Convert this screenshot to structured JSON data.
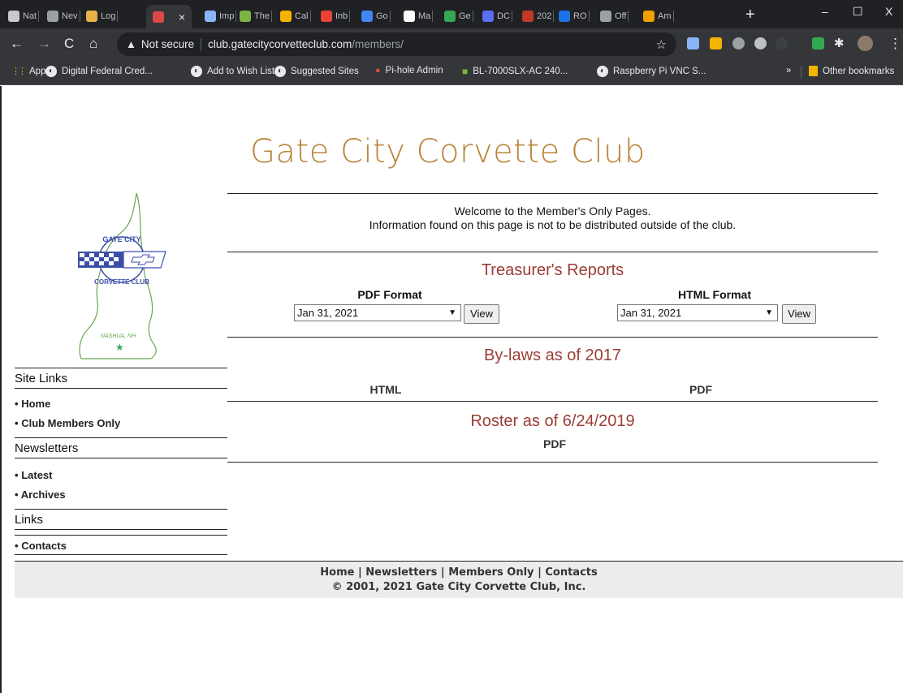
{
  "browser": {
    "tabs": [
      {
        "label": "Nat",
        "color": "#c9c9c9"
      },
      {
        "label": "Nev",
        "color": "#9aa0a6"
      },
      {
        "label": "Log",
        "color": "#e8b04b"
      },
      {
        "label": "",
        "color": "#e04848",
        "active": true
      },
      {
        "label": "Imp",
        "color": "#8ab4f8"
      },
      {
        "label": "The",
        "color": "#7cb342"
      },
      {
        "label": "Cal",
        "color": "#f4b400"
      },
      {
        "label": "Inb",
        "color": "#ea4335"
      },
      {
        "label": "Go",
        "color": "#4285f4"
      },
      {
        "label": "Ma",
        "color": "#ffffff"
      },
      {
        "label": "Ge",
        "color": "#34a853"
      },
      {
        "label": "DC",
        "color": "#5b6df0"
      },
      {
        "label": "202",
        "color": "#c0392b"
      },
      {
        "label": "RO",
        "color": "#1a73e8"
      },
      {
        "label": "Off",
        "color": "#9aa0a6"
      },
      {
        "label": "Am",
        "color": "#f0a000"
      }
    ],
    "active_tab_close": "×",
    "new_tab": "+",
    "window_controls": {
      "minimize": "–",
      "maximize": "☐",
      "close": "X"
    },
    "address": {
      "security_label": "Not secure",
      "host": "club.gatecitycorvetteclub.com",
      "path": "/members/"
    },
    "bookmarks": [
      {
        "label": "Apps",
        "icon": "apps-grid-icon"
      },
      {
        "label": "Digital Federal Cred...",
        "icon": "globe-icon"
      },
      {
        "label": "Add to Wish List",
        "icon": "globe-icon"
      },
      {
        "label": "Suggested Sites",
        "icon": "globe-icon"
      },
      {
        "label": "Pi-hole Admin",
        "icon": "pihole-icon"
      },
      {
        "label": "BL-7000SLX-AC 240...",
        "icon": "plugin-icon"
      },
      {
        "label": "Raspberry Pi VNC S...",
        "icon": "globe-icon"
      }
    ],
    "more_bookmarks": "»",
    "other_bookmarks": "Other bookmarks"
  },
  "site": {
    "title": "Gate City Corvette Club",
    "welcome_line1": "Welcome to the Member's Only Pages.",
    "welcome_line2": "Information found on this page is not to be distributed outside of the club.",
    "treasurer": {
      "title": "Treasurer's Reports",
      "pdf_label": "PDF Format",
      "pdf_selected": "Jan 31, 2021",
      "html_label": "HTML Format",
      "html_selected": "Jan 31, 2021",
      "view_label": "View"
    },
    "bylaws": {
      "title": "By-laws as of 2017",
      "html_link": "HTML",
      "pdf_link": "PDF"
    },
    "roster": {
      "title": "Roster as of 6/24/2019",
      "pdf_link": "PDF"
    }
  },
  "logo": {
    "arc_top": "GATE CITY",
    "arc_bottom": "CORVETTE CLUB",
    "location": "NASHUA, NH"
  },
  "sidebar": {
    "site_links": "Site Links",
    "home": "Home",
    "members_only": "Club Members Only",
    "newsletters": "Newsletters",
    "latest": "Latest",
    "archives": "Archives",
    "links": "Links",
    "contacts": "Contacts",
    "bullet": "•"
  },
  "footer": {
    "home": "Home",
    "newsletters": "Newsletters",
    "members_only": "Members Only",
    "contacts": "Contacts",
    "separator": "|",
    "copyright": "© 2001, 2021 Gate City Corvette Club, Inc."
  }
}
